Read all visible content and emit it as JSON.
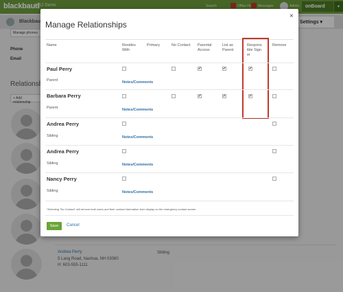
{
  "app": {
    "logo": "blackbaud",
    "site": "K-12 Demo",
    "top_items": [
      "Search",
      "Office Hours",
      "Messages"
    ],
    "badges": [
      "24",
      "2"
    ],
    "user": "Admin",
    "onboard": "onBoard",
    "caret": "▾",
    "settings_label": "Settings ▾"
  },
  "profile": {
    "name": "Blackbaud",
    "manage_phones_label": "Manage phones",
    "phone_label": "Phone",
    "email_label": "Email",
    "relationships_heading": "Relationships",
    "add_relationship_label": "+ Add relationship"
  },
  "bg_person": {
    "name": "Andrea Perry",
    "address_line1": "5 Lang Road, Nashua, NH 03060",
    "phone": "H: 603-555-1111",
    "role": "Sibling"
  },
  "modal": {
    "title": "Manage Relationships",
    "close": "×",
    "columns": {
      "name": "Name",
      "resides_with": "Resides With",
      "primary": "Primary",
      "no_contact": "No Contact",
      "parental_access": "Parental Access",
      "list_as_parent": "List as Parent",
      "responsible_signer": "Responsible Signer",
      "remove": "Remove"
    },
    "notes_label": "Notes/Comments",
    "rows": [
      {
        "name": "Paul Perry",
        "relation": "Parent",
        "resides_with": false,
        "no_contact": false,
        "parental_access": true,
        "list_as_parent": true,
        "responsible_signer": true,
        "remove": false
      },
      {
        "name": "Barbara Perry",
        "relation": "Parent",
        "resides_with": false,
        "no_contact": false,
        "parental_access": true,
        "list_as_parent": true,
        "responsible_signer": true,
        "remove": false
      },
      {
        "name": "Andrea Perry",
        "relation": "Sibling",
        "resides_with": false,
        "remove": false
      },
      {
        "name": "Andrea Perry",
        "relation": "Sibling",
        "resides_with": false,
        "remove": false
      },
      {
        "name": "Nancy Perry",
        "relation": "Sibling",
        "resides_with": false,
        "remove": false
      }
    ],
    "footnote": "*Selecting \"No Contact\" will remove both users and their contact information from display on the emergency contact screen.",
    "save_label": "Save",
    "cancel_label": "Cancel"
  },
  "colors": {
    "accent": "#6aa536",
    "link": "#2f6fa6",
    "highlight": "#c0392b"
  }
}
